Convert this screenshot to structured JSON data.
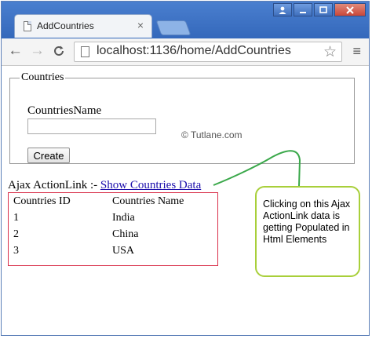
{
  "window": {
    "controls": [
      "person",
      "minimize",
      "maximize",
      "close"
    ]
  },
  "tab": {
    "title": "AddCountries",
    "close_label": "×"
  },
  "toolbar": {
    "back": "←",
    "forward": "→",
    "reload": "C",
    "url": "localhost:1136/home/AddCountries",
    "star": "☆",
    "menu": "≡"
  },
  "form": {
    "legend": "Countries",
    "field_label": "CountriesName",
    "input_value": "",
    "create_label": "Create",
    "watermark": "© Tutlane.com"
  },
  "ajax": {
    "prefix": "Ajax ActionLink :- ",
    "link_text": "Show Countries Data"
  },
  "table": {
    "headers": [
      "Countries ID",
      "Countries Name"
    ],
    "rows": [
      [
        "1",
        "India"
      ],
      [
        "2",
        "China"
      ],
      [
        "3",
        "USA"
      ]
    ]
  },
  "callout": {
    "text": "Clicking on this Ajax ActionLink data is getting Populated in Html Elements"
  },
  "colors": {
    "callout_border": "#a8cf3a",
    "connector": "#3aa84a",
    "table_border": "#d9304a",
    "link": "#1a0dab"
  }
}
